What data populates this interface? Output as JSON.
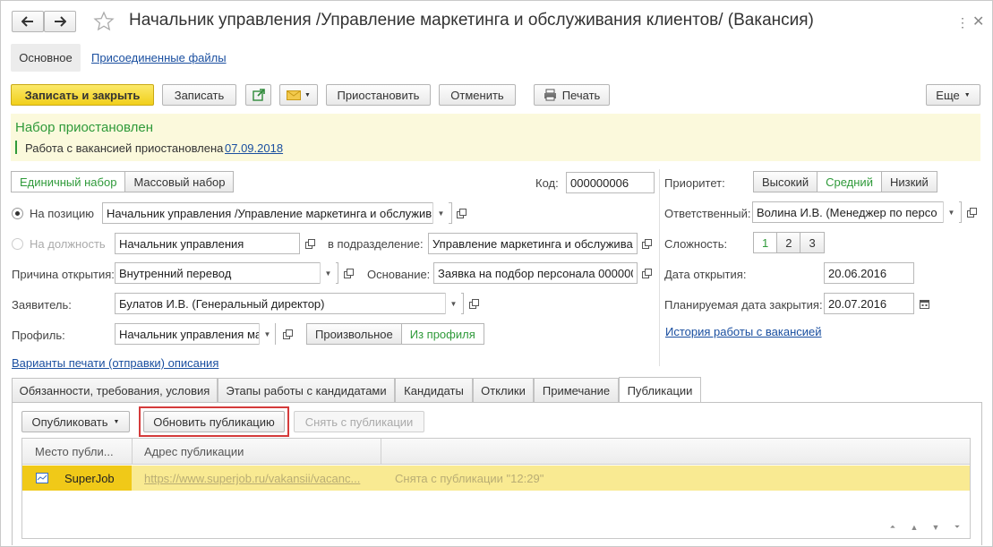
{
  "window": {
    "title": "Начальник управления /Управление маркетинга и обслуживания клиентов/ (Вакансия)"
  },
  "nav": {
    "main_label": "Основное",
    "attached_files": "Присоединенные файлы"
  },
  "toolbar": {
    "save_close": "Записать и закрыть",
    "save": "Записать",
    "suspend": "Приостановить",
    "cancel": "Отменить",
    "print": "Печать",
    "more": "Еще"
  },
  "banner": {
    "title": "Набор приостановлен",
    "text": "Работа с вакансией приостановлена",
    "date": "07.09.2018",
    "bg_color": "#fbf9dc",
    "title_color": "#2f9a3a"
  },
  "form": {
    "mode_single": "Единичный набор",
    "mode_mass": "Массовый набор",
    "code_label": "Код:",
    "code_value": "000000006",
    "on_position_label": "На позицию",
    "on_position_value": "Начальник управления /Управление маркетинга и обслужив",
    "on_role_label": "На должность",
    "on_role_value": "Начальник управления",
    "dept_label": "в подразделение:",
    "dept_value": "Управление маркетинга и обслуживан",
    "reason_label": "Причина открытия:",
    "reason_value": "Внутренний перевод",
    "basis_label": "Основание:",
    "basis_value": "Заявка на подбор персонала 000000",
    "applicant_label": "Заявитель:",
    "applicant_value": "Булатов И.В. (Генеральный директор)",
    "profile_label": "Профиль:",
    "profile_value": "Начальник управления ма",
    "profile_free": "Произвольное",
    "profile_from": "Из профиля",
    "print_variants": "Варианты печати (отправки) описания"
  },
  "right": {
    "priority_label": "Приоритет:",
    "priority_options": [
      "Высокий",
      "Средний",
      "Низкий"
    ],
    "priority_selected": "Средний",
    "responsible_label": "Ответственный:",
    "responsible_value": "Волина И.В. (Менеджер по персо",
    "complexity_label": "Сложность:",
    "complexity_options": [
      "1",
      "2",
      "3"
    ],
    "complexity_selected": "1",
    "open_date_label": "Дата открытия:",
    "open_date_value": "20.06.2016",
    "close_date_label": "Планируемая дата закрытия:",
    "close_date_value": "20.07.2016",
    "history_link": "История работы с вакансией"
  },
  "tabs": [
    "Обязанности, требования, условия",
    "Этапы работы с кандидатами",
    "Кандидаты",
    "Отклики",
    "Примечание",
    "Публикации"
  ],
  "active_tab": "Публикации",
  "publications": {
    "publish_btn": "Опубликовать",
    "update_btn": "Обновить публикацию",
    "remove_btn": "Снять с публикации",
    "col_place": "Место публи...",
    "col_address": "Адрес публикации",
    "rows": [
      {
        "place": "SuperJob",
        "address": "https://www.superjob.ru/vakansii/vacanc...",
        "status": "Снята с публикации \"12:29\""
      }
    ],
    "highlight_color": "#d43b3b",
    "row_color": "#f9ea92"
  }
}
